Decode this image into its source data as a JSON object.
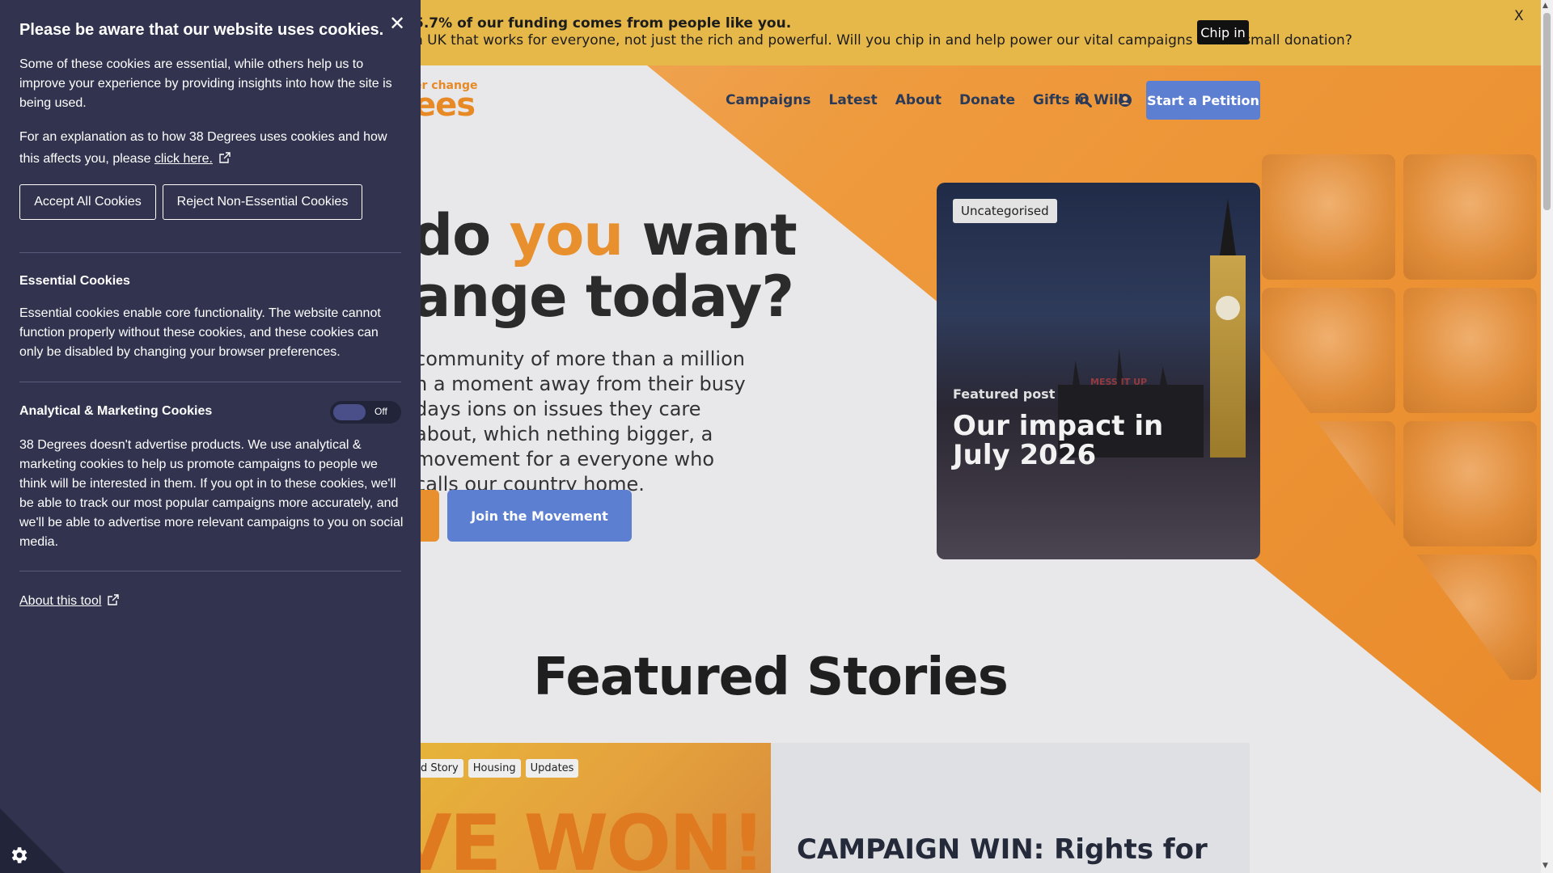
{
  "banner": {
    "line1": "5.7% of our funding comes from people like you.",
    "line2": "n UK that works for everyone, not just the rich and powerful. Will you chip in and help power our vital campaigns with a small donation?",
    "chip_in_label": "Chip in",
    "close_label": "X"
  },
  "logo": {
    "small": "er change",
    "big": "ees"
  },
  "nav": {
    "items": [
      "Campaigns",
      "Latest",
      "About",
      "Donate",
      "Gifts in Wills"
    ],
    "search_icon": "search-icon",
    "account_icon": "user-icon",
    "petition_label": "Start a Petition"
  },
  "hero": {
    "headline_part1": " do ",
    "headline_accent": "you",
    "headline_part2": " want",
    "headline_line2": "ange today?",
    "intro": "community of more than a million n a moment away from their busy days ions on issues they care about, which nething bigger, a movement for a everyone who calls our country home.",
    "join_label": "Join the Movement",
    "accent_color": "#e8902d",
    "button_color": "#5c7fd2"
  },
  "feature_card": {
    "tag": "Uncategorised",
    "subtitle": "Featured post",
    "title": "Our impact in July 2026"
  },
  "featured": {
    "heading": "Featured Stories",
    "story_tags": [
      "ed Story",
      "Housing",
      "Updates"
    ],
    "story_image_text": "VE WON!",
    "story_title": "CAMPAIGN WIN: Rights for"
  },
  "cookie": {
    "title": "Please be aware that our website uses cookies.",
    "intro": "Some of these cookies are essential, while others help us to improve your experience by providing insights into how the site is being used.",
    "explain_prefix": "For an explanation as to how 38 Degrees uses cookies and how this affects you, please ",
    "explain_link": "click here.",
    "accept_label": "Accept All Cookies",
    "reject_label": "Reject Non-Essential Cookies",
    "essential_heading": "Essential Cookies",
    "essential_text": "Essential cookies enable core functionality. The website cannot function properly without these cookies, and these cookies can only be disabled by changing your browser preferences.",
    "analytics_heading": "Analytical & Marketing Cookies",
    "analytics_toggle_state": "Off",
    "analytics_text": "38 Degrees doesn't advertise products. We use analytical & marketing cookies to help us promote campaigns to people we think will be interested in them. If you opt in to these cookies, we'll be able to track our most popular campaigns more accurately, and we'll be able to advertise more relevant campaigns to you on social media.",
    "about_tool": "About this tool",
    "panel_color": "#32344f"
  }
}
